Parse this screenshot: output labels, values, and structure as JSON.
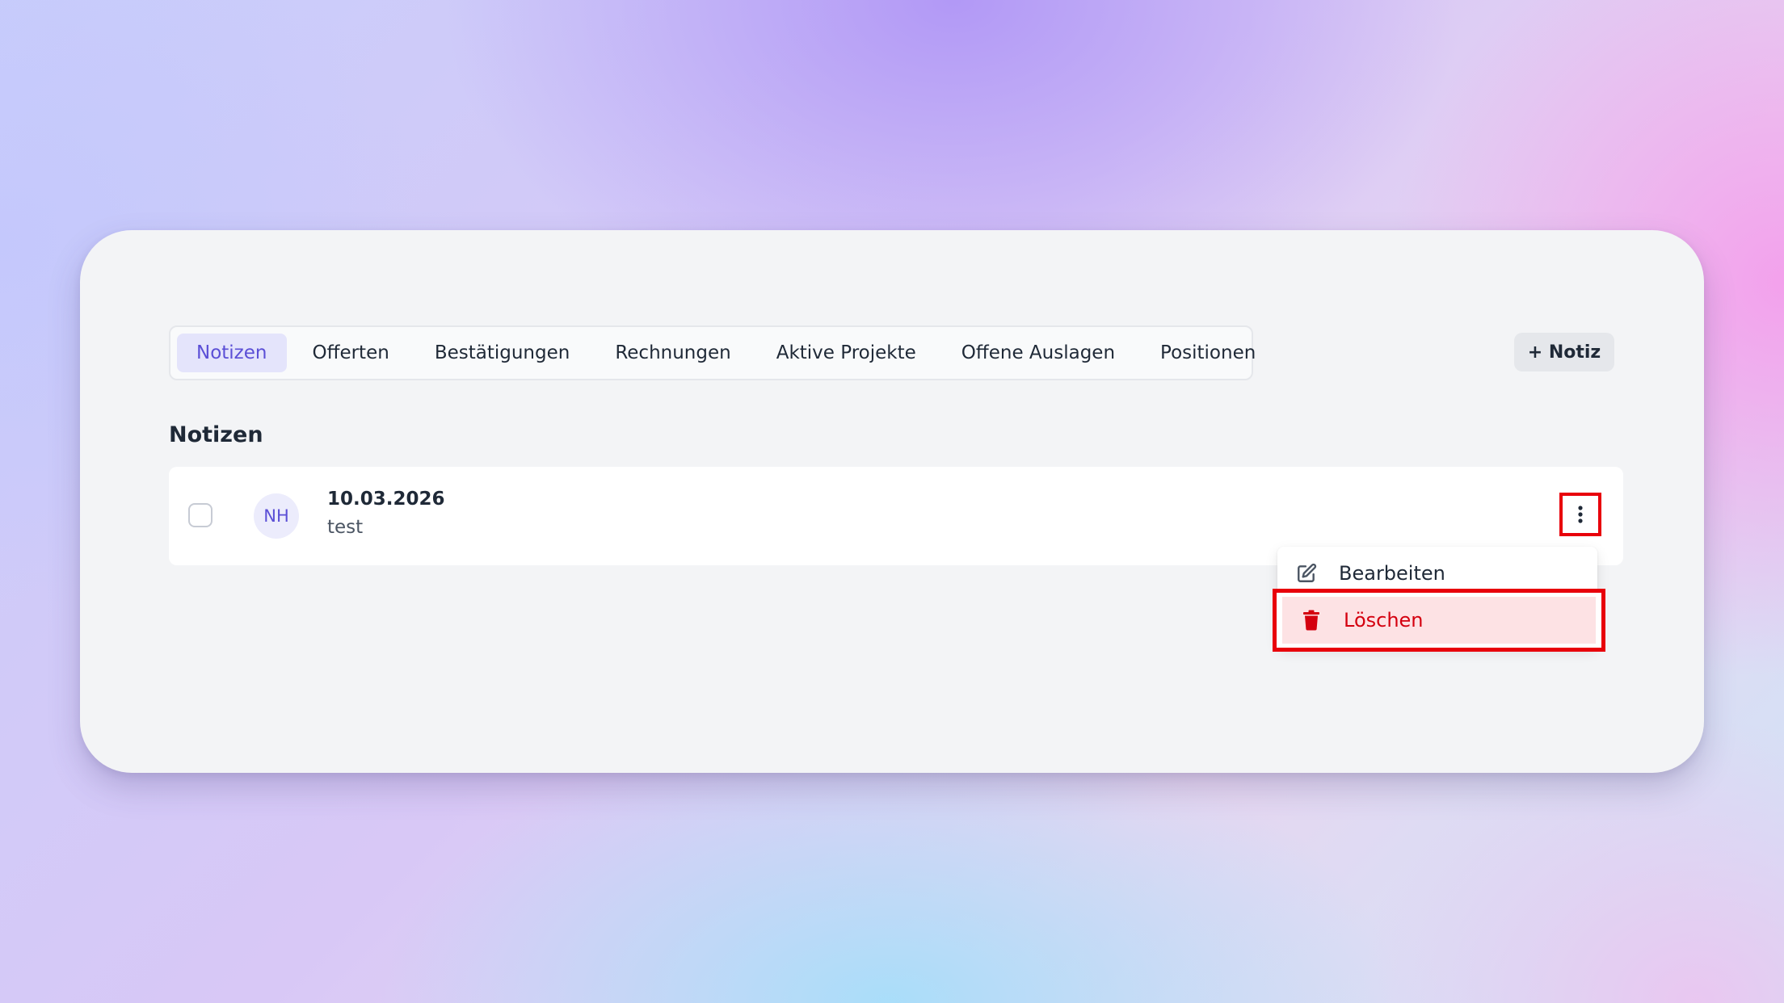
{
  "tabs": [
    {
      "label": "Notizen",
      "active": true
    },
    {
      "label": "Offerten",
      "active": false
    },
    {
      "label": "Bestätigungen",
      "active": false
    },
    {
      "label": "Rechnungen",
      "active": false
    },
    {
      "label": "Aktive Projekte",
      "active": false
    },
    {
      "label": "Offene Auslagen",
      "active": false
    },
    {
      "label": "Positionen",
      "active": false
    }
  ],
  "toolbar": {
    "add_note_label": "+ Notiz"
  },
  "section": {
    "title": "Notizen"
  },
  "notes": [
    {
      "initials": "NH",
      "date": "10.03.2026",
      "text": "test"
    }
  ],
  "context_menu": {
    "items": [
      {
        "label": "Bearbeiten",
        "icon": "edit-icon"
      },
      {
        "label": "Löschen",
        "icon": "trash-icon"
      }
    ]
  },
  "colors": {
    "accent": "#5b4fd6",
    "active_tab_bg": "#e4e4fb",
    "danger": "#d4000f",
    "danger_bg": "#fde2e4",
    "highlight_border": "#e8000b"
  }
}
